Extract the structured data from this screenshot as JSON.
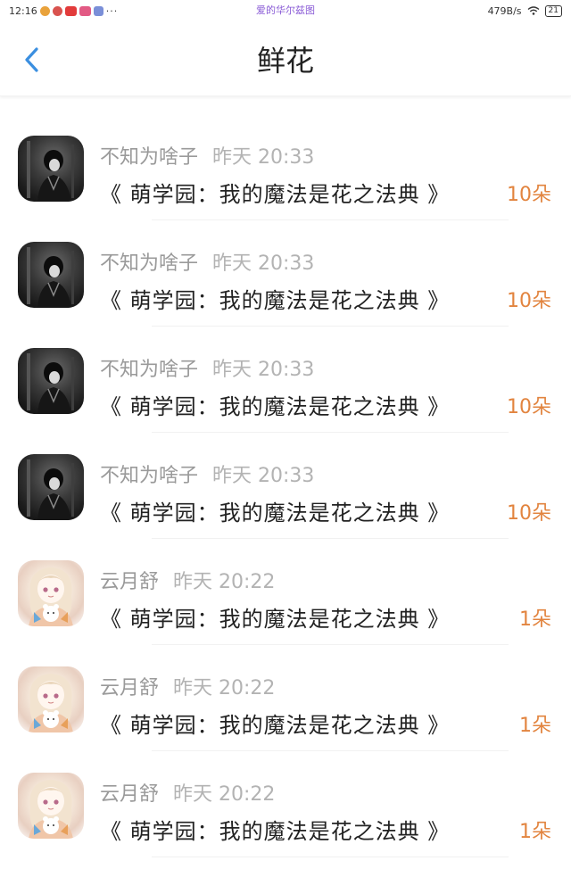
{
  "status_bar": {
    "time": "12:16",
    "more": "···",
    "center_text": "爱的华尔兹图",
    "speed": "479B/s",
    "battery": "21"
  },
  "header": {
    "title": "鲜花"
  },
  "gifts": [
    {
      "user": "不知为啥子",
      "time": "昨天 20:33",
      "book": "《 萌学园：我的魔法是花之法典 》",
      "amount": "10朵",
      "avatar": "dark-avatar"
    },
    {
      "user": "不知为啥子",
      "time": "昨天 20:33",
      "book": "《 萌学园：我的魔法是花之法典 》",
      "amount": "10朵",
      "avatar": "dark-avatar"
    },
    {
      "user": "不知为啥子",
      "time": "昨天 20:33",
      "book": "《 萌学园：我的魔法是花之法典 》",
      "amount": "10朵",
      "avatar": "dark-avatar"
    },
    {
      "user": "不知为啥子",
      "time": "昨天 20:33",
      "book": "《 萌学园：我的魔法是花之法典 》",
      "amount": "10朵",
      "avatar": "dark-avatar"
    },
    {
      "user": "云月舒",
      "time": "昨天 20:22",
      "book": "《 萌学园：我的魔法是花之法典 》",
      "amount": "1朵",
      "avatar": "light-avatar"
    },
    {
      "user": "云月舒",
      "time": "昨天 20:22",
      "book": "《 萌学园：我的魔法是花之法典 》",
      "amount": "1朵",
      "avatar": "light-avatar"
    },
    {
      "user": "云月舒",
      "time": "昨天 20:22",
      "book": "《 萌学园：我的魔法是花之法典 》",
      "amount": "1朵",
      "avatar": "light-avatar"
    }
  ],
  "colors": {
    "back_arrow": "#3b8fe0",
    "amount": "#e2843f",
    "secondary_text": "#9a9a9a"
  }
}
